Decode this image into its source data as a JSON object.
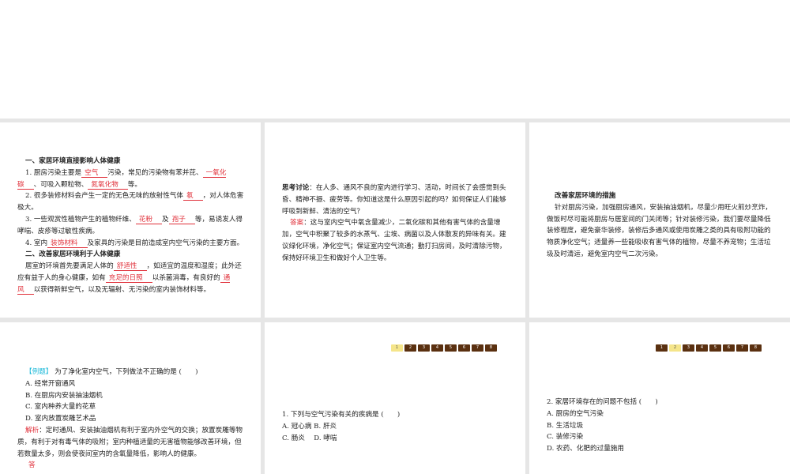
{
  "panel1": {
    "h1": "一、家居环境直接影响人体健康",
    "p1": [
      "1. 厨房污染主要是",
      "空气",
      "污染，常见的污染物有苯并芘、",
      "一氧化碳",
      "、可吸入颗粒物、",
      "氮氧化物",
      "等。"
    ],
    "p2": [
      "2. 很多装修材料会产生一定的无色无味的放射性气体",
      "氡",
      "，对人体危害极大。"
    ],
    "p3": [
      "3. 一些观赏性植物产生的植物纤维、",
      "花粉",
      "及",
      "孢子",
      "等，易诱发人得哮喘、皮疹等过敏性疾病。"
    ],
    "p4": [
      "4. 室内",
      "装饰材料",
      "及家具的污染是目前造成室内空气污染的主要方面。"
    ],
    "h2": "二、改善家居环境利于人体健康",
    "p5": [
      "居室的环境首先要满足人体的",
      "舒适性",
      "，如适宜的温度和湿度；此外还应有益于人的身心健康，如有",
      "充足的日照",
      "以杀菌消毒，有良好的",
      "通风",
      "以获得新鲜空气，以及无辐射、无污染的室内装饰材料等。"
    ]
  },
  "panel2": {
    "q_label": "思考讨论",
    "q_text": "：在人多、通风不良的室内进行学习、活动，时间长了会感觉到头昏、精神不振、疲劳等。你知道这是什么原因引起的吗？如何保证人们能够呼吸到新鲜、清洁的空气？",
    "a_label": "答案",
    "a_text": "：这与室内空气中氧含量减少，二氧化碳和其他有害气体的含量增加，空气中积聚了较多的水蒸气、尘埃、病菌以及人体散发的异味有关。建议绿化环境，净化空气；保证室内空气流通；勤打扫房间，及时清除污物，保持好环境卫生和做好个人卫生等。"
  },
  "panel3": {
    "title": "改善家居环境的措施",
    "text": "针对厨房污染，加强厨房通风，安装抽油烟机，尽量少用旺火煎炒烹炸，做饭时尽可能将厨房与居室间的门关闭等；针对装修污染，我们要尽量降低装修程度，避免豪华装修，装修后多通风或使用炭雕之类的具有吸附功能的物质净化空气；适量养一些能吸收有害气体的植物，尽量不养宠物；生活垃圾及时清运，避免室内空气二次污染。"
  },
  "panel4": {
    "tag": "【例题】",
    "question": "为了净化室内空气，下列做法不正确的是 (　　)",
    "options": [
      "A. 经常开窗通风",
      "B. 在厨房内安装抽油烟机",
      "C. 室内种养大量的花草",
      "D. 室内放置炭雕艺术品"
    ],
    "analysis_label": "解析",
    "analysis": "：定时通风、安装抽油烟机有利于室内外空气的交换；放置炭雕等物质，有利于对有毒气体的吸附；室内种植适量的无害植物能够改善环境，但若数量太多，则会使夜间室内的含氧量降低，影响人的健康。",
    "answer_label": "答"
  },
  "panel5": {
    "pages": [
      "1",
      "2",
      "3",
      "4",
      "5",
      "6",
      "7",
      "8"
    ],
    "active_page": "1",
    "question": "1. 下列与空气污染有关的疾病是 (　　)",
    "options_line1": "A. 冠心病 B. 肝炎",
    "options_line2": "C. 肠炎　 D. 哮喘"
  },
  "panel6": {
    "pages": [
      "1",
      "2",
      "3",
      "4",
      "5",
      "6",
      "7",
      "8"
    ],
    "active_page": "2",
    "question": "2. 家居环境存在的问题不包括 (　　)",
    "options": [
      "A. 厨房的空气污染",
      "B. 生活垃圾",
      "C. 装修污染",
      "D. 农药、化肥的过量施用"
    ]
  }
}
